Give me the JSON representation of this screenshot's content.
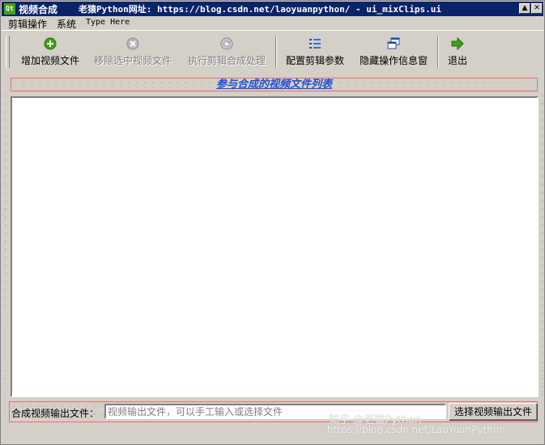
{
  "window": {
    "app_icon": "Qt",
    "title": "视频合成",
    "title_url": "老猿Python网址: https://blog.csdn.net/laoyuanpython/ - ui_mixClips.ui",
    "min_symbol": "▲",
    "close_symbol": "✕"
  },
  "menubar": {
    "items": [
      {
        "label": "剪辑操作"
      },
      {
        "label": "系统"
      },
      {
        "label": "Type Here"
      }
    ]
  },
  "toolbar": {
    "items": [
      {
        "label": "增加视频文件",
        "icon": "add-circle-icon",
        "enabled": true
      },
      {
        "label": "移除选中视频文件",
        "icon": "remove-circle-icon",
        "enabled": false
      },
      {
        "label": "执行剪辑合成处理",
        "icon": "process-icon",
        "enabled": false
      },
      {
        "label": "配置剪辑参数",
        "icon": "list-config-icon",
        "enabled": true
      },
      {
        "label": "隐藏操作信息窗",
        "icon": "window-icon",
        "enabled": true
      },
      {
        "label": "退出",
        "icon": "exit-arrow-icon",
        "enabled": true
      }
    ]
  },
  "main": {
    "list_title": "参与合成的视频文件列表",
    "output_label": "合成视频输出文件：",
    "output_placeholder": "视频输出文件，可以手工输入或选择文件",
    "output_value": "",
    "choose_button_label": "选择视频输出文件"
  },
  "watermark": {
    "brand": "知乎 @老猿Python",
    "url": "https://blog.csdn.net/LaoYuanPython"
  },
  "colors": {
    "titlebar": "#0a246a",
    "list_title_text": "#1f4fd8",
    "red_outline": "#f06a6a",
    "icon_green": "#41a317"
  }
}
